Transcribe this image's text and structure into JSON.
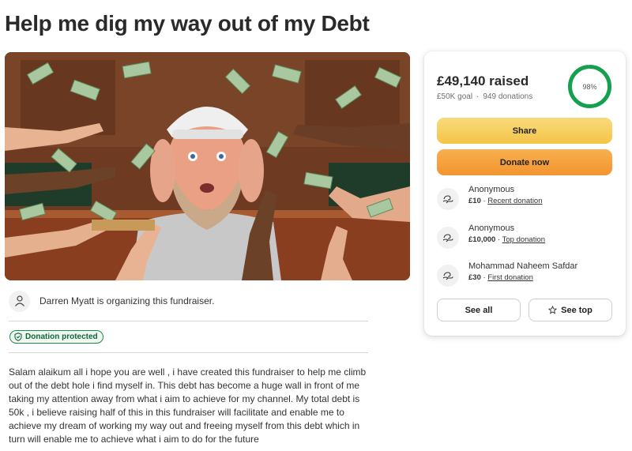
{
  "page": {
    "title": "Help me dig my way out of my Debt"
  },
  "organizer": {
    "text": "Darren Myatt is organizing this fundraiser."
  },
  "badge": {
    "label": "Donation protected"
  },
  "story": {
    "text": "Salam alaikum all i hope you are well , i have created this fundraiser to help me climb out of the debt hole i find myself in. This debt has become a huge wall in front of me taking my attention away from what i aim to achieve for my channel. My total debt is 50k , i believe raising half of this in this fundraiser will facilitate and enable me to achieve my dream of working my way out and freeing myself from this debt which in turn will enable me to achieve what i aim to do for the future"
  },
  "card": {
    "raised": "£49,140 raised",
    "goal": "£50K goal",
    "donations": "949 donations",
    "progress_label": "98%",
    "progress_value": 0.98,
    "share_label": "Share",
    "donate_label": "Donate now",
    "see_all_label": "See all",
    "see_top_label": "See top"
  },
  "donations": [
    {
      "name": "Anonymous",
      "amount": "£10",
      "tag": "Recent donation"
    },
    {
      "name": "Anonymous",
      "amount": "£10,000",
      "tag": "Top donation"
    },
    {
      "name": "Mohammad Naheem Safdar",
      "amount": "£30",
      "tag": "First donation"
    }
  ],
  "colors": {
    "progress": "#14a04e",
    "share": "#f5cb55",
    "donate": "#f4a03a",
    "badge": "#1e8a4a"
  }
}
